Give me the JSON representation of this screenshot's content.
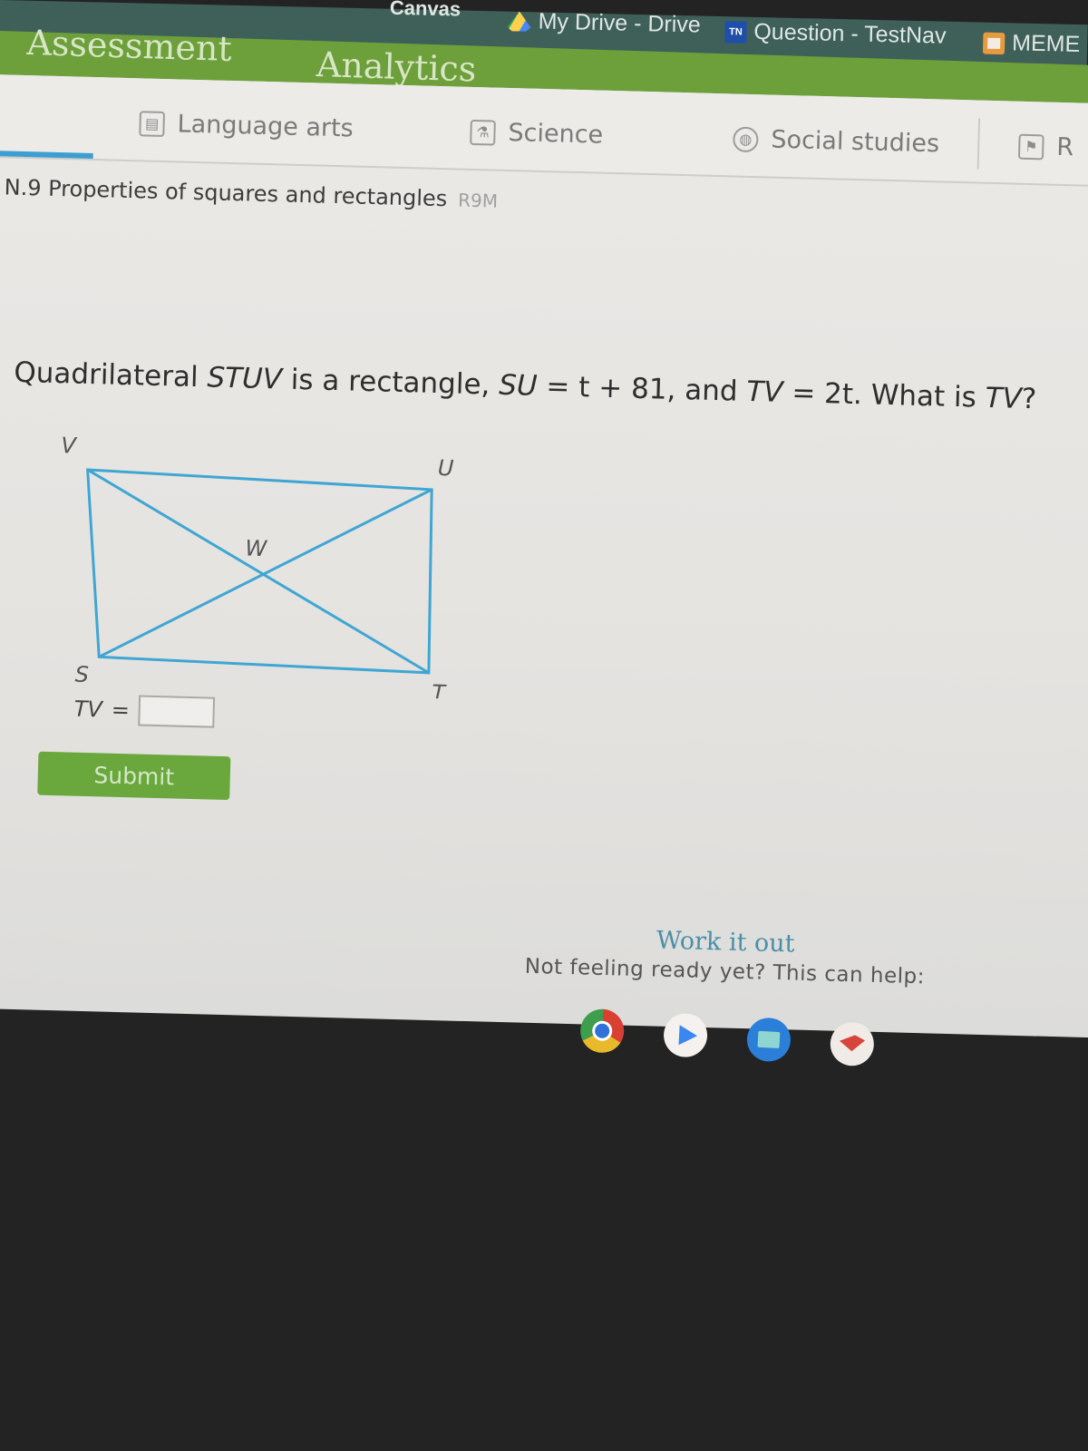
{
  "bookmarks": [
    {
      "label": "Canvas",
      "icon": "canvas-icon"
    },
    {
      "label": "My Drive - Drive",
      "icon": "google-drive-icon"
    },
    {
      "label": "Question - TestNav",
      "icon": "testnav-icon",
      "icon_text": "TN"
    },
    {
      "label": "MEME",
      "icon": "bookmark-folder-icon"
    }
  ],
  "top_nav": {
    "items": [
      "Assessment",
      "Analytics"
    ]
  },
  "subjects": [
    {
      "label": "Language arts",
      "icon": "book-icon"
    },
    {
      "label": "Science",
      "icon": "flask-icon"
    },
    {
      "label": "Social studies",
      "icon": "globe-icon"
    },
    {
      "label": "R",
      "icon": "signpost-icon"
    }
  ],
  "skill": {
    "title": "N.9 Properties of squares and rectangles",
    "code": "R9M"
  },
  "question": {
    "prefix": "Quadrilateral ",
    "shape": "STUV",
    "mid1": " is a rectangle, ",
    "eq1_lhs": "SU",
    "eq1_rhs": " = t + 81, and ",
    "eq2_lhs": "TV",
    "eq2_rhs": " = 2t. What is ",
    "ask": "TV",
    "suffix": "?"
  },
  "diagram": {
    "vertices": {
      "V": "V",
      "U": "U",
      "S": "S",
      "T": "T",
      "W": "W"
    },
    "stroke_color": "#3fa6d3"
  },
  "answer": {
    "label": "TV",
    "equals": "=",
    "value": ""
  },
  "submit_label": "Submit",
  "help": {
    "title": "Work it out",
    "subtitle": "Not feeling ready yet? This can help:"
  },
  "shelf": [
    {
      "name": "Chrome"
    },
    {
      "name": "Play Store"
    },
    {
      "name": "Files"
    },
    {
      "name": "Reader"
    }
  ],
  "colors": {
    "green_nav": "#6d9f3b",
    "bookmarks_bar": "#3f5f59",
    "accent_blue": "#3c9ed1",
    "submit_green": "#6aa83e"
  }
}
